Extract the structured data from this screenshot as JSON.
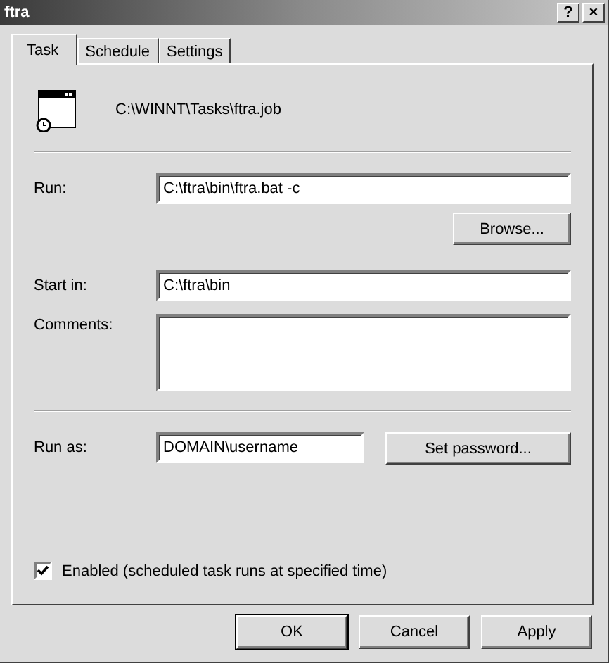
{
  "window": {
    "title": "ftra",
    "help_button": "?",
    "close_button": "×"
  },
  "tabs": [
    {
      "label": "Task",
      "selected": true
    },
    {
      "label": "Schedule",
      "selected": false
    },
    {
      "label": "Settings",
      "selected": false
    }
  ],
  "task_file": "C:\\WINNT\\Tasks\\ftra.job",
  "run": {
    "label": "Run:",
    "value": "C:\\ftra\\bin\\ftra.bat -c"
  },
  "browse_button": {
    "label": "Browse..."
  },
  "start_in": {
    "label": "Start in:",
    "value": "C:\\ftra\\bin"
  },
  "comments": {
    "label": "Comments:"
  },
  "run_as": {
    "label": "Run as:",
    "value": "DOMAIN\\username"
  },
  "set_password_button": {
    "label": "Set password..."
  },
  "enabled": {
    "label": "Enabled (scheduled task runs at specified time)",
    "checked": true
  },
  "buttons": [
    {
      "label": "OK",
      "default": true
    },
    {
      "label": "Cancel",
      "default": false
    },
    {
      "label": "Apply",
      "default": false
    }
  ]
}
